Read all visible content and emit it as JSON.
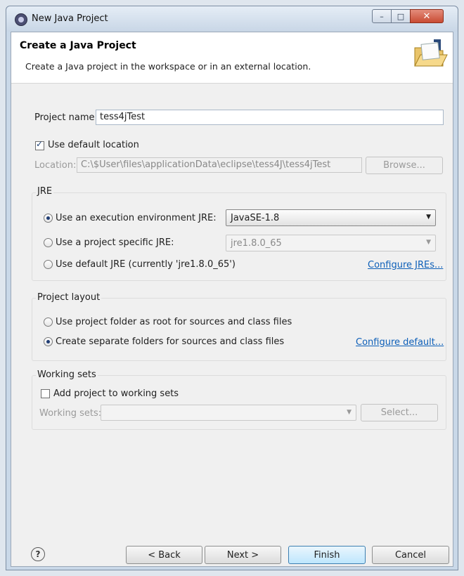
{
  "window": {
    "title": "New Java Project",
    "minimize": "–",
    "maximize": "□",
    "close": "✕"
  },
  "banner": {
    "title": "Create a Java Project",
    "description": "Create a Java project in the workspace or in an external location.",
    "icon": "java-folder-icon"
  },
  "project": {
    "name_label": "Project name:",
    "name_value": "tess4jTest",
    "use_default_location_label": "Use default location",
    "use_default_location_checked": true,
    "location_label": "Location:",
    "location_value": "C:\\$User\\files\\applicationData\\eclipse\\tess4J\\tess4jTest",
    "browse_label": "Browse..."
  },
  "jre": {
    "group_title": "JRE",
    "option_exec_env": "Use an execution environment JRE:",
    "exec_env_value": "JavaSE-1.8",
    "option_specific": "Use a project specific JRE:",
    "specific_value": "jre1.8.0_65",
    "option_default": "Use default JRE (currently 'jre1.8.0_65')",
    "configure_link": "Configure JREs...",
    "selected": "exec_env"
  },
  "layout": {
    "group_title": "Project layout",
    "option_root": "Use project folder as root for sources and class files",
    "option_separate": "Create separate folders for sources and class files",
    "configure_link": "Configure default...",
    "selected": "separate"
  },
  "working_sets": {
    "group_title": "Working sets",
    "add_label": "Add project to working sets",
    "add_checked": false,
    "sets_label": "Working sets:",
    "select_label": "Select..."
  },
  "footer": {
    "help": "?",
    "back": "< Back",
    "next": "Next >",
    "finish": "Finish",
    "cancel": "Cancel"
  }
}
